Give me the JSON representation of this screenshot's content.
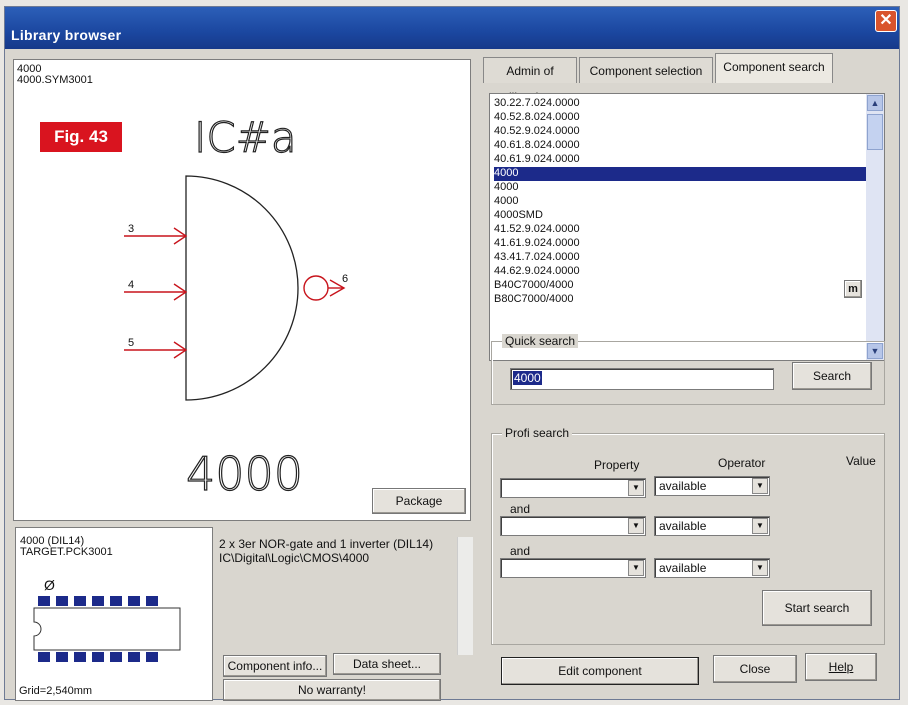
{
  "window": {
    "title": "Library browser",
    "close": "✕"
  },
  "symbol": {
    "name_line1": "4000",
    "name_line2": "4000.SYM3001",
    "gate_label_top": "IC#a",
    "gate_label_bottom": "4000",
    "pins": [
      "3",
      "4",
      "5",
      "6"
    ],
    "figure_badge": "Fig. 43",
    "package_button": "Package"
  },
  "package": {
    "name_line1": "4000 (DIL14)",
    "name_line2": "TARGET.PCK3001",
    "pin_marker": "Ø",
    "grid": "Grid=2,540mm"
  },
  "info": {
    "line1": "2 x 3er NOR-gate and 1 inverter  (DIL14)",
    "line2": "IC\\Digital\\Logic\\CMOS\\4000",
    "component_info_button": "Component info...",
    "data_sheet_button": "Data sheet...",
    "no_warranty_button": "No warranty!"
  },
  "tabs": [
    {
      "label": "Admin of libraries",
      "active": false
    },
    {
      "label": "Component selection",
      "active": false
    },
    {
      "label": "Component search",
      "active": true
    }
  ],
  "results": {
    "items": [
      "30.22.7.024.0000",
      "40.52.8.024.0000",
      "40.52.9.024.0000",
      "40.61.8.024.0000",
      "40.61.9.024.0000",
      "4000",
      "4000",
      "4000",
      "4000SMD",
      "41.52.9.024.0000",
      "41.61.9.024.0000",
      "43.41.7.024.0000",
      "44.62.9.024.0000",
      "B40C7000/4000",
      "B80C7000/4000"
    ],
    "selected_index": 5,
    "m_button": "m"
  },
  "quick_search": {
    "label": "Quick search",
    "value": "4000",
    "search_button": "Search"
  },
  "profi_search": {
    "label": "Profi search",
    "col_property": "Property",
    "col_operator": "Operator",
    "col_value": "Value",
    "and1": "and",
    "and2": "and",
    "operators": [
      "available",
      "available",
      "available"
    ],
    "start_button": "Start search"
  },
  "footer": {
    "edit_button": "Edit component",
    "close_button": "Close",
    "help_button": "Help"
  },
  "colors": {
    "accent_red": "#d9141f",
    "selection": "#1c2a8a",
    "title_blue": "#1b47a0"
  }
}
